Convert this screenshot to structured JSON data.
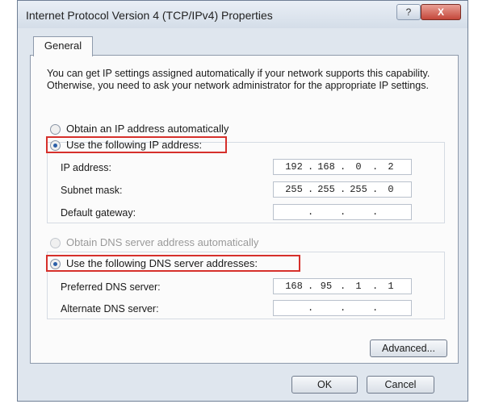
{
  "window": {
    "title": "Internet Protocol Version 4 (TCP/IPv4) Properties",
    "help_label": "?",
    "close_label": "X"
  },
  "tabs": [
    {
      "label": "General"
    }
  ],
  "intro": "You can get IP settings assigned automatically if your network supports this capability. Otherwise, you need to ask your network administrator for the appropriate IP settings.",
  "ip": {
    "auto_label": "Obtain an IP address automatically",
    "manual_label": "Use the following IP address:",
    "selected": "manual",
    "fields": [
      {
        "label": "IP address:",
        "octets": [
          "192",
          "168",
          "0",
          "2"
        ]
      },
      {
        "label": "Subnet mask:",
        "octets": [
          "255",
          "255",
          "255",
          "0"
        ]
      },
      {
        "label": "Default gateway:",
        "octets": [
          "",
          "",
          "",
          ""
        ]
      }
    ]
  },
  "dns": {
    "auto_label": "Obtain DNS server address automatically",
    "manual_label": "Use the following DNS server addresses:",
    "selected": "manual",
    "auto_disabled": true,
    "fields": [
      {
        "label": "Preferred DNS server:",
        "octets": [
          "168",
          "95",
          "1",
          "1"
        ]
      },
      {
        "label": "Alternate DNS server:",
        "octets": [
          "",
          "",
          "",
          ""
        ]
      }
    ]
  },
  "buttons": {
    "advanced": "Advanced...",
    "ok": "OK",
    "cancel": "Cancel"
  },
  "colors": {
    "highlight": "#d6302b",
    "radio_checked": "#2c5fa8"
  }
}
